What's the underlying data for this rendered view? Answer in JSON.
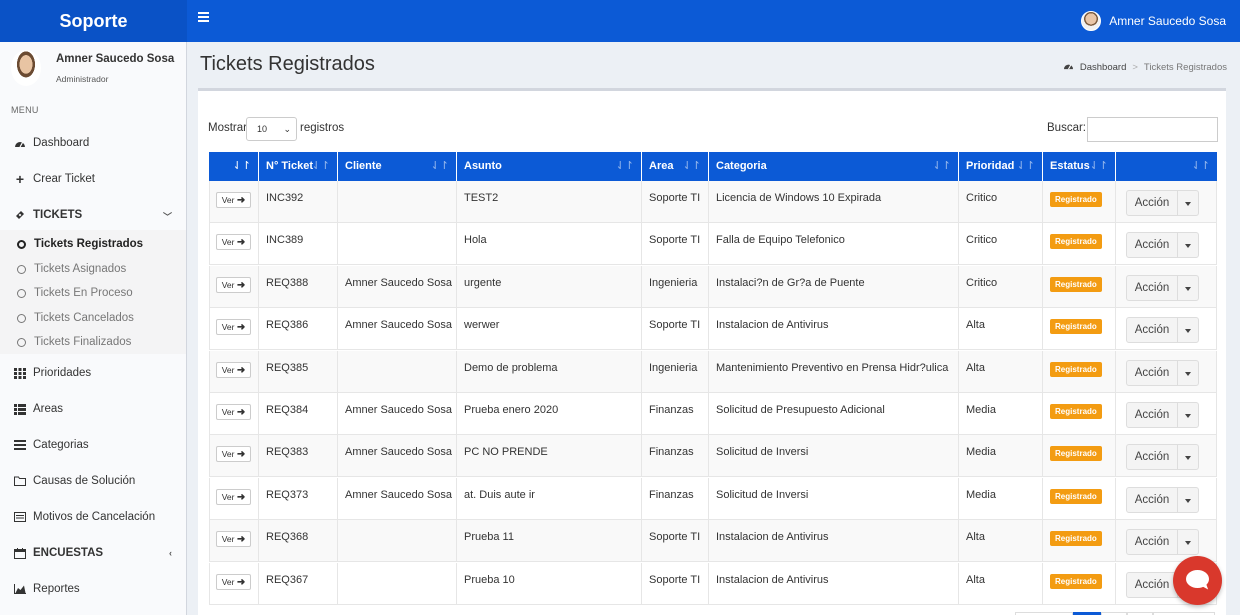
{
  "header": {
    "brand": "Soporte",
    "user_name": "Amner Saucedo Sosa"
  },
  "sidebar": {
    "user_name": "Amner Saucedo Sosa",
    "user_role": "Administrador",
    "menu_header": "MENU",
    "items": [
      {
        "label": "Dashboard",
        "icon": "dashboard-icon"
      },
      {
        "label": "Crear Ticket",
        "icon": "plus-icon"
      },
      {
        "label": "TICKETS",
        "icon": "ticket-icon"
      },
      {
        "label": "Prioridades",
        "icon": "grid-icon"
      },
      {
        "label": "Areas",
        "icon": "list-icon"
      },
      {
        "label": "Categorias",
        "icon": "bars-icon"
      },
      {
        "label": "Causas de Solución",
        "icon": "folder-icon"
      },
      {
        "label": "Motivos de Cancelación",
        "icon": "card-icon"
      },
      {
        "label": "ENCUESTAS",
        "icon": "calendar-icon"
      },
      {
        "label": "Reportes",
        "icon": "chart-icon"
      }
    ],
    "tickets_submenu": [
      {
        "label": "Tickets Registrados",
        "active": true
      },
      {
        "label": "Tickets Asignados"
      },
      {
        "label": "Tickets En Proceso"
      },
      {
        "label": "Tickets Cancelados"
      },
      {
        "label": "Tickets Finalizados"
      }
    ]
  },
  "content": {
    "title": "Tickets Registrados",
    "breadcrumb": [
      "Dashboard",
      "Tickets Registrados"
    ],
    "length_label_before": "Mostrar",
    "length_value": "10",
    "length_label_after": "registros",
    "search_label": "Buscar:",
    "search_value": ""
  },
  "table": {
    "columns": [
      "",
      "N° Ticket",
      "Cliente",
      "Asunto",
      "Area",
      "Categoria",
      "Prioridad",
      "Estatus",
      ""
    ],
    "view_label": "Ver",
    "action_label": "Acción",
    "rows": [
      {
        "ticket": "INC392",
        "cliente": "",
        "asunto": "TEST2",
        "area": "Soporte TI",
        "categoria": "Licencia de Windows 10 Expirada",
        "prioridad": "Critico",
        "estatus": "Registrado"
      },
      {
        "ticket": "INC389",
        "cliente": "",
        "asunto": "Hola",
        "area": "Soporte TI",
        "categoria": "Falla de Equipo Telefonico",
        "prioridad": "Critico",
        "estatus": "Registrado"
      },
      {
        "ticket": "REQ388",
        "cliente": "Amner Saucedo Sosa",
        "asunto": "urgente",
        "area": "Ingenieria",
        "categoria": "Instalaci?n de Gr?a de Puente",
        "prioridad": "Critico",
        "estatus": "Registrado"
      },
      {
        "ticket": "REQ386",
        "cliente": "Amner Saucedo Sosa",
        "asunto": "werwer",
        "area": "Soporte TI",
        "categoria": "Instalacion de Antivirus",
        "prioridad": "Alta",
        "estatus": "Registrado"
      },
      {
        "ticket": "REQ385",
        "cliente": "",
        "asunto": "Demo de problema",
        "area": "Ingenieria",
        "categoria": "Mantenimiento Preventivo en Prensa Hidr?ulica",
        "prioridad": "Alta",
        "estatus": "Registrado"
      },
      {
        "ticket": "REQ384",
        "cliente": "Amner Saucedo Sosa",
        "asunto": "Prueba enero 2020",
        "area": "Finanzas",
        "categoria": "Solicitud de Presupuesto Adicional",
        "prioridad": "Media",
        "estatus": "Registrado"
      },
      {
        "ticket": "REQ383",
        "cliente": "Amner Saucedo Sosa",
        "asunto": "PC NO PRENDE",
        "area": "Finanzas",
        "categoria": "Solicitud de Inversi",
        "prioridad": "Media",
        "estatus": "Registrado"
      },
      {
        "ticket": "REQ373",
        "cliente": "Amner Saucedo Sosa",
        "asunto": "at. Duis aute ir",
        "area": "Finanzas",
        "categoria": "Solicitud de Inversi",
        "prioridad": "Media",
        "estatus": "Registrado"
      },
      {
        "ticket": "REQ368",
        "cliente": "",
        "asunto": "Prueba 11",
        "area": "Soporte TI",
        "categoria": "Instalacion de Antivirus",
        "prioridad": "Alta",
        "estatus": "Registrado"
      },
      {
        "ticket": "REQ367",
        "cliente": "",
        "asunto": "Prueba 10",
        "area": "Soporte TI",
        "categoria": "Instalacion de Antivirus",
        "prioridad": "Alta",
        "estatus": "Registrado"
      }
    ]
  },
  "colors": {
    "primary": "#0c5ad6",
    "badge": "#f39c12",
    "chat": "#d9382c"
  }
}
